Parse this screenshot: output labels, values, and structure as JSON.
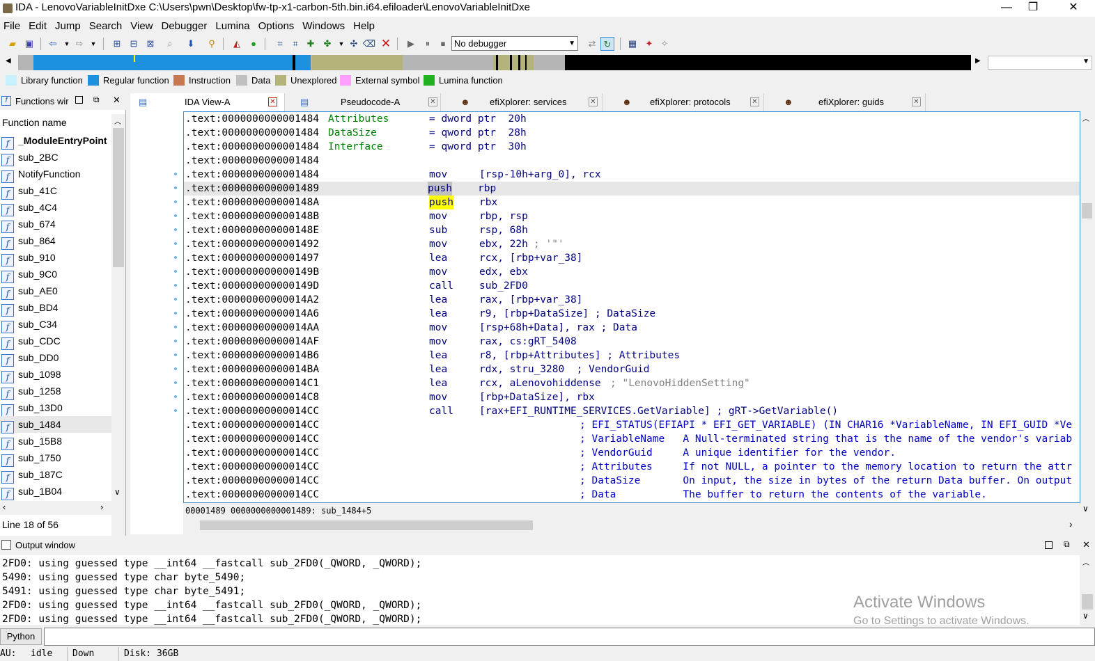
{
  "window": {
    "title": "IDA - LenovoVariableInitDxe C:\\Users\\pwn\\Desktop\\fw-tp-x1-carbon-5th.bin.i64.efiloader\\LenovoVariableInitDxe",
    "minimize": "—",
    "maximize": "❐",
    "close": "✕"
  },
  "menu": [
    "File",
    "Edit",
    "Jump",
    "Search",
    "View",
    "Debugger",
    "Lumina",
    "Options",
    "Windows",
    "Help"
  ],
  "toolbar": {
    "debugger_select": "No debugger"
  },
  "legend": [
    {
      "label": "Library function",
      "color": "#c8f0ff"
    },
    {
      "label": "Regular function",
      "color": "#1e90e0"
    },
    {
      "label": "Instruction",
      "color": "#c87850"
    },
    {
      "label": "Data",
      "color": "#c0c0c0"
    },
    {
      "label": "Unexplored",
      "color": "#b4b47a"
    },
    {
      "label": "External symbol",
      "color": "#ffa0ff"
    },
    {
      "label": "Lumina function",
      "color": "#20b020"
    }
  ],
  "functions_panel": {
    "title": "Functions wir",
    "column": "Function name",
    "items": [
      "_ModuleEntryPoint",
      "sub_2BC",
      "NotifyFunction",
      "sub_41C",
      "sub_4C4",
      "sub_674",
      "sub_864",
      "sub_910",
      "sub_9C0",
      "sub_AE0",
      "sub_BD4",
      "sub_C34",
      "sub_CDC",
      "sub_DD0",
      "sub_1098",
      "sub_1258",
      "sub_13D0",
      "sub_1484",
      "sub_15B8",
      "sub_1750",
      "sub_187C",
      "sub_1B04"
    ],
    "selected": "sub_1484",
    "line_status": "Line 18 of 56"
  },
  "tabs": [
    {
      "label": "IDA View-A",
      "active": true
    },
    {
      "label": "Pseudocode-A",
      "active": false
    },
    {
      "label": "efiXplorer: services",
      "active": false
    },
    {
      "label": "efiXplorer: protocols",
      "active": false
    },
    {
      "label": "efiXplorer: guids",
      "active": false
    }
  ],
  "code_lines": [
    {
      "addr": ".text:0000000000001484",
      "m": "Attributes",
      "o": "= dword ptr  20h",
      "t": "decl"
    },
    {
      "addr": ".text:0000000000001484",
      "m": "DataSize",
      "o": "= qword ptr  28h",
      "t": "decl"
    },
    {
      "addr": ".text:0000000000001484",
      "m": "Interface",
      "o": "= qword ptr  30h",
      "t": "decl"
    },
    {
      "addr": ".text:0000000000001484",
      "m": "",
      "o": "",
      "t": "blank"
    },
    {
      "addr": ".text:0000000000001484",
      "m": "mov",
      "o": "[rsp-10h+arg_0], rcx",
      "t": "ins"
    },
    {
      "addr": ".text:0000000000001489",
      "m": "push",
      "o": "rbp",
      "t": "ins"
    },
    {
      "addr": ".text:000000000000148A",
      "m": "push",
      "o": "rbx",
      "t": "ins"
    },
    {
      "addr": ".text:000000000000148B",
      "m": "mov",
      "o": "rbp, rsp",
      "t": "ins"
    },
    {
      "addr": ".text:000000000000148E",
      "m": "sub",
      "o": "rsp, 68h",
      "t": "ins"
    },
    {
      "addr": ".text:0000000000001492",
      "m": "mov",
      "o": "ebx, 22h",
      "c": "; '\"'",
      "t": "ins"
    },
    {
      "addr": ".text:0000000000001497",
      "m": "lea",
      "o": "rcx, [rbp+var_38]",
      "t": "ins"
    },
    {
      "addr": ".text:000000000000149B",
      "m": "mov",
      "o": "edx, ebx",
      "t": "ins"
    },
    {
      "addr": ".text:000000000000149D",
      "m": "call",
      "o": "sub_2FD0",
      "t": "ins"
    },
    {
      "addr": ".text:00000000000014A2",
      "m": "lea",
      "o": "rax, [rbp+var_38]",
      "t": "ins"
    },
    {
      "addr": ".text:00000000000014A6",
      "m": "lea",
      "o": "r9, [rbp+DataSize] ; DataSize",
      "t": "ins"
    },
    {
      "addr": ".text:00000000000014AA",
      "m": "mov",
      "o": "[rsp+68h+Data], rax ; Data",
      "t": "ins"
    },
    {
      "addr": ".text:00000000000014AF",
      "m": "mov",
      "o": "rax, cs:gRT_5408",
      "t": "ins"
    },
    {
      "addr": ".text:00000000000014B6",
      "m": "lea",
      "o": "r8, [rbp+Attributes] ; Attributes",
      "t": "ins"
    },
    {
      "addr": ".text:00000000000014BA",
      "m": "lea",
      "o": "rdx, stru_3280  ; VendorGuid",
      "t": "ins"
    },
    {
      "addr": ".text:00000000000014C1",
      "m": "lea",
      "o": "rcx, aLenovohiddense",
      "c": "; \"LenovoHiddenSetting\"",
      "t": "ins"
    },
    {
      "addr": ".text:00000000000014C8",
      "m": "mov",
      "o": "[rbp+DataSize], rbx",
      "t": "ins"
    },
    {
      "addr": ".text:00000000000014CC",
      "m": "call",
      "o": "[rax+EFI_RUNTIME_SERVICES.GetVariable] ; gRT->GetVariable()",
      "t": "ins"
    },
    {
      "addr": ".text:00000000000014CC",
      "m": "",
      "o": "; EFI_STATUS(EFIAPI * EFI_GET_VARIABLE) (IN CHAR16 *VariableName, IN EFI_GUID *Ve",
      "t": "cmt"
    },
    {
      "addr": ".text:00000000000014CC",
      "m": "",
      "o": "; VariableName   A Null-terminated string that is the name of the vendor's variab",
      "t": "cmt"
    },
    {
      "addr": ".text:00000000000014CC",
      "m": "",
      "o": "; VendorGuid     A unique identifier for the vendor.",
      "t": "cmt"
    },
    {
      "addr": ".text:00000000000014CC",
      "m": "",
      "o": "; Attributes     If not NULL, a pointer to the memory location to return the attr",
      "t": "cmt"
    },
    {
      "addr": ".text:00000000000014CC",
      "m": "",
      "o": "; DataSize       On input, the size in bytes of the return Data buffer. On output",
      "t": "cmt"
    },
    {
      "addr": ".text:00000000000014CC",
      "m": "",
      "o": "; Data           The buffer to return the contents of the variable.",
      "t": "cmt"
    }
  ],
  "code_status": "00001489 0000000000001489: sub_1484+5",
  "output_window": {
    "title": "Output window",
    "lines": [
      "2FD0: using guessed type __int64 __fastcall sub_2FD0(_QWORD, _QWORD);",
      "5490: using guessed type char byte_5490;",
      "5491: using guessed type char byte_5491;",
      "2FD0: using guessed type __int64 __fastcall sub_2FD0(_QWORD, _QWORD);",
      "2FD0: using guessed type __int64 __fastcall sub_2FD0(_QWORD, _QWORD);"
    ]
  },
  "python_button": "Python",
  "statusbar": {
    "au": "AU:",
    "state": "idle",
    "dir": "Down",
    "disk": "Disk: 36GB"
  },
  "watermark": {
    "line1": "Activate Windows",
    "line2": "Go to Settings to activate Windows."
  }
}
